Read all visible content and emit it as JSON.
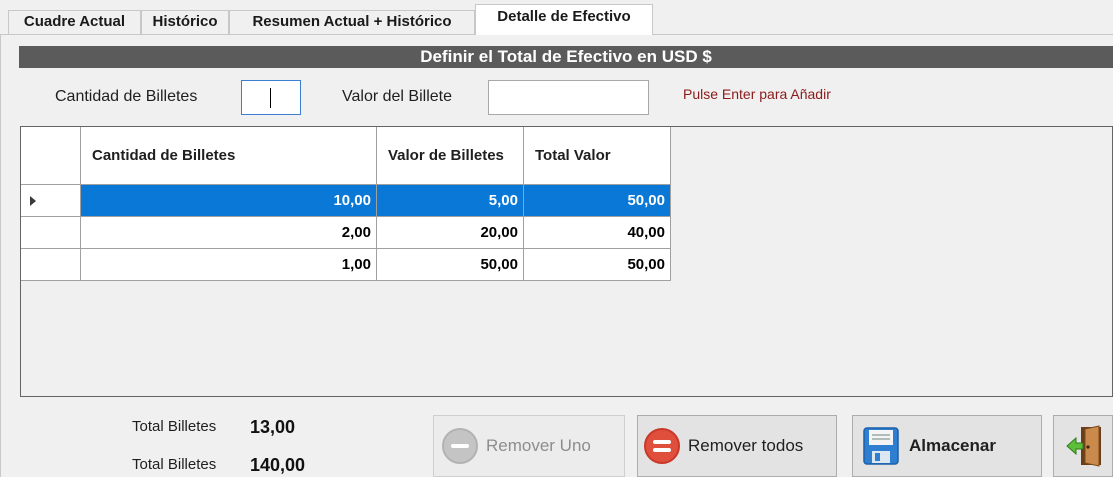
{
  "tabs": [
    {
      "label": "Cuadre Actual"
    },
    {
      "label": "Histórico"
    },
    {
      "label": "Resumen Actual + Histórico"
    },
    {
      "label": "Detalle de Efectivo"
    }
  ],
  "active_tab": "Detalle de Efectivo",
  "section_title": "Definir el Total de Efectivo en USD $",
  "form": {
    "cantidad_label": "Cantidad de Billetes",
    "cantidad_value": "",
    "valor_label": "Valor del Billete",
    "valor_value": "",
    "hint": "Pulse Enter para Añadir"
  },
  "grid": {
    "columns": [
      "Cantidad de Billetes",
      "Valor de Billetes",
      "Total Valor"
    ],
    "rows": [
      [
        "10,00",
        "5,00",
        "50,00"
      ],
      [
        "2,00",
        "20,00",
        "40,00"
      ],
      [
        "1,00",
        "50,00",
        "50,00"
      ]
    ],
    "selected_row": 0
  },
  "totals": {
    "count_label": "Total Billetes",
    "count_value": "13,00",
    "amount_label": "Total Billetes",
    "amount_value": "140,00"
  },
  "buttons": {
    "remove_one": "Remover Uno",
    "remove_all": "Remover todos",
    "save": "Almacenar"
  },
  "icons": {
    "remove_one": "minus-circle-icon",
    "remove_all": "equals-circle-icon",
    "save": "floppy-disk-icon",
    "exit": "exit-door-icon"
  },
  "colors": {
    "selection": "#0a78d7",
    "title_bar": "#5b5b5b",
    "hint": "#8b1a1a",
    "remove_all_icon": "#e04e3c"
  }
}
